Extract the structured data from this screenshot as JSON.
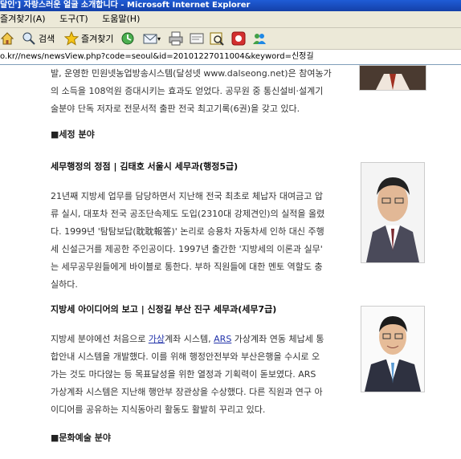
{
  "window": {
    "title": "달인'] 자랑스러운 얼굴 소개합니다 - Microsoft Internet Explorer"
  },
  "menu": {
    "items": [
      "즐겨찾기(A)",
      "도구(T)",
      "도움말(H)"
    ]
  },
  "toolbar": {
    "search_label": "검색",
    "favorites_label": "즐겨찾기"
  },
  "address": {
    "url": "o.kr//news/newsView.php?code=seoul&id=20101227011004&keyword=신정길"
  },
  "article": {
    "intro_lines": [
      "발, 운영한 민원넷농업방송시스템(달성넷 www.dalseong.net)은 참여농가",
      "의 소득을 108억원 증대시키는 효과도 얻었다. 공무원 중 통신설비·설계기",
      "술분야 단독 저자로 전문서적 출판 전국 최고기록(6권)을 갖고 있다."
    ],
    "section1": "■세정 분야",
    "person1": {
      "heading": "세무행정의 정점 | 김태호 서울시 세무과(행정5급)",
      "lines": [
        "21년째 지방세 업무를 담당하면서 지난해 전국 최초로 체납자 대여금고 압",
        "류 실시, 대포차 전국 공조단속제도 도입(2310대 강제견인)의 실적을 올렸",
        "다. 1999년 '탐탐보답(耽耽報答)' 논리로 승용차 자동차세 인하 대신 주행",
        "세 신설근거를 제공한 주인공이다. 1997년 출간한 '지방세의 이론과 실무'",
        "는 세무공무원들에게 바이블로 통한다. 부하 직원들에 대한 멘토 역할도 충",
        "실하다."
      ]
    },
    "person2": {
      "heading": "지방세 아이디어의 보고 | 신정길 부산 진구 세무과(세무7급)",
      "line1_a": "지방세 분야에선 처음으로 ",
      "line1_link1": "가상",
      "line1_b": "계좌 시스템, ",
      "line1_link2": "ARS",
      "line1_c": " 가상계좌 연동 체납세 통",
      "lines": [
        "합안내 시스템을 개발했다. 이를 위해 행정안전부와 부산은행을 수시로 오",
        "가는 것도 마다않는 등 목표달성을 위한 열정과 기획력이 돋보였다. ARS",
        "가상계좌 시스템은 지난해 행안부 장관상을 수상했다. 다른 직원과 연구 아",
        "이디어를 공유하는 지식동아리 활동도 활발히 꾸리고 있다."
      ]
    },
    "section2": "■문화예술 분야"
  }
}
